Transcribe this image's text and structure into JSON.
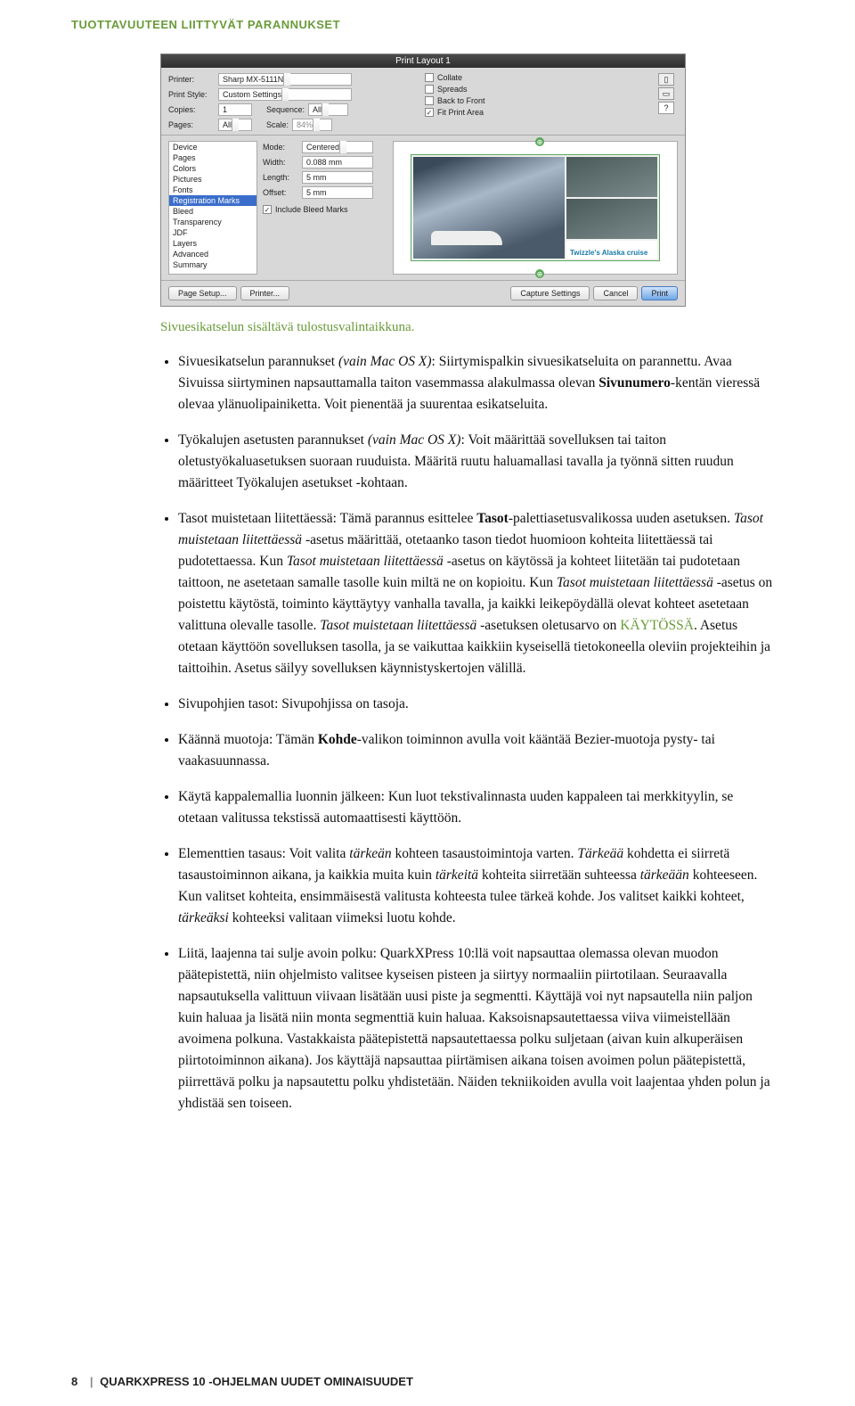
{
  "breadcrumb": "TUOTTAVUUTEEN LIITTYVÄT PARANNUKSET",
  "dialog": {
    "title": "Print Layout 1",
    "labels": {
      "printer": "Printer:",
      "printStyle": "Print Style:",
      "copies": "Copies:",
      "sequence": "Sequence:",
      "pages": "Pages:",
      "scale": "Scale:",
      "mode": "Mode:",
      "width": "Width:",
      "length": "Length:",
      "offset": "Offset:"
    },
    "values": {
      "printer": "Sharp MX-5111N",
      "printStyle": "Custom Settings",
      "copies": "1",
      "sequence": "All",
      "pages": "All",
      "scale": "84%",
      "mode": "Centered",
      "width": "0.088 mm",
      "length": "5 mm",
      "offset": "5 mm"
    },
    "checks": {
      "collate": "Collate",
      "spreads": "Spreads",
      "backToFront": "Back to Front",
      "fitPrintArea": "Fit Print Area",
      "includeBleed": "Include Bleed Marks"
    },
    "listItems": [
      "Device",
      "Pages",
      "Colors",
      "Pictures",
      "Fonts",
      "Registration Marks",
      "Bleed",
      "Transparency",
      "JDF",
      "Layers",
      "Advanced",
      "Summary"
    ],
    "listSelected": "Registration Marks",
    "previewCaption": "Twizzle's Alaska cruise",
    "helpIcon": "?",
    "buttons": {
      "pageSetup": "Page Setup...",
      "printer": "Printer...",
      "capture": "Capture Settings",
      "cancel": "Cancel",
      "print": "Print"
    }
  },
  "caption": "Sivuesikatselun sisältävä tulostusvalintaikkuna.",
  "bullets": {
    "b1a": "Sivuesikatselun parannukset ",
    "b1b": "(vain Mac OS X)",
    "b1c": ": Siirtymispalkin sivuesikatseluita on parannettu. Avaa Sivuissa siirtyminen napsauttamalla taiton vasemmassa alakulmassa olevan ",
    "b1d": "Sivunumero",
    "b1e": "-kentän vieressä olevaa ylänuolipainiketta. Voit pienentää ja suurentaa esikatseluita.",
    "b2a": "Työkalujen asetusten parannukset ",
    "b2b": "(vain Mac OS X)",
    "b2c": ": Voit määrittää sovelluksen tai taiton oletustyökaluasetuksen suoraan ruuduista. Määritä ruutu haluamallasi tavalla ja työnnä sitten ruudun määritteet Työkalujen asetukset -kohtaan.",
    "b3a": "Tasot muistetaan liitettäessä: Tämä parannus esittelee ",
    "b3b": "Tasot",
    "b3c": "-palettiasetusvalikossa uuden asetuksen. ",
    "b3d": "Tasot muistetaan liitettäessä",
    "b3e": " -asetus määrittää, otetaanko tason tiedot huomioon kohteita liitettäessä tai pudotettaessa. Kun ",
    "b3f": "Tasot muistetaan liitettäessä",
    "b3g": " -asetus on käytössä ja kohteet liitetään tai pudotetaan taittoon, ne asetetaan samalle tasolle kuin miltä ne on kopioitu. Kun ",
    "b3h": "Tasot muistetaan liitettäessä",
    "b3i": " -asetus on poistettu käytöstä, toiminto käyttäytyy vanhalla tavalla, ja kaikki leikepöydällä olevat kohteet asetetaan valittuna olevalle tasolle. ",
    "b3j": "Tasot muistetaan liitettäessä",
    "b3k": " -asetuksen oletusarvo on ",
    "b3l": "KÄYTÖSSÄ",
    "b3m": ". Asetus otetaan käyttöön sovelluksen tasolla, ja se vaikuttaa kaikkiin kyseisellä tietokoneella oleviin projekteihin ja taittoihin. Asetus säilyy sovelluksen käynnistyskertojen välillä.",
    "b4": "Sivupohjien tasot: Sivupohjissa on tasoja.",
    "b5a": "Käännä muotoja: Tämän ",
    "b5b": "Kohde",
    "b5c": "-valikon toiminnon avulla voit kääntää Bezier-muotoja pysty- tai vaakasuunnassa.",
    "b6": "Käytä kappalemallia luonnin jälkeen: Kun luot tekstivalinnasta uuden kappaleen tai merkkityylin, se otetaan valitussa tekstissä automaattisesti käyttöön.",
    "b7a": "Elementtien tasaus: Voit valita ",
    "b7b": "tärkeän",
    "b7c": " kohteen tasaustoimintoja varten. ",
    "b7d": "Tärkeää",
    "b7e": " kohdetta ei siirretä tasaustoiminnon aikana, ja kaikkia muita kuin ",
    "b7f": "tärkeitä",
    "b7g": " kohteita siirretään suhteessa ",
    "b7h": "tärkeään",
    "b7i": " kohteeseen. Kun valitset kohteita, ensimmäisestä valitusta kohteesta tulee tärkeä kohde. Jos valitset kaikki kohteet, ",
    "b7j": "tärkeäksi",
    "b7k": " kohteeksi valitaan viimeksi luotu kohde.",
    "b8": "Liitä, laajenna tai sulje avoin polku: QuarkXPress 10:llä voit napsauttaa olemassa olevan muodon päätepistettä, niin ohjelmisto valitsee kyseisen pisteen ja siirtyy normaaliin piirtotilaan. Seuraavalla napsautuksella valittuun viivaan lisätään uusi piste ja segmentti. Käyttäjä voi nyt napsautella niin paljon kuin haluaa ja lisätä niin monta segmenttiä kuin haluaa. Kaksoisnapsautettaessa viiva viimeistellään avoimena polkuna. Vastakkaista päätepistettä napsautettaessa polku suljetaan (aivan kuin alkuperäisen piirtotoiminnon aikana). Jos käyttäjä napsauttaa piirtämisen aikana toisen avoimen polun päätepistettä, piirrettävä polku ja napsautettu polku yhdistetään. Näiden tekniikoiden avulla voit laajentaa yhden polun ja yhdistää sen toiseen."
  },
  "footer": {
    "page": "8",
    "sep": "|",
    "title": "QUARKXPRESS 10 -OHJELMAN UUDET OMINAISUUDET"
  }
}
